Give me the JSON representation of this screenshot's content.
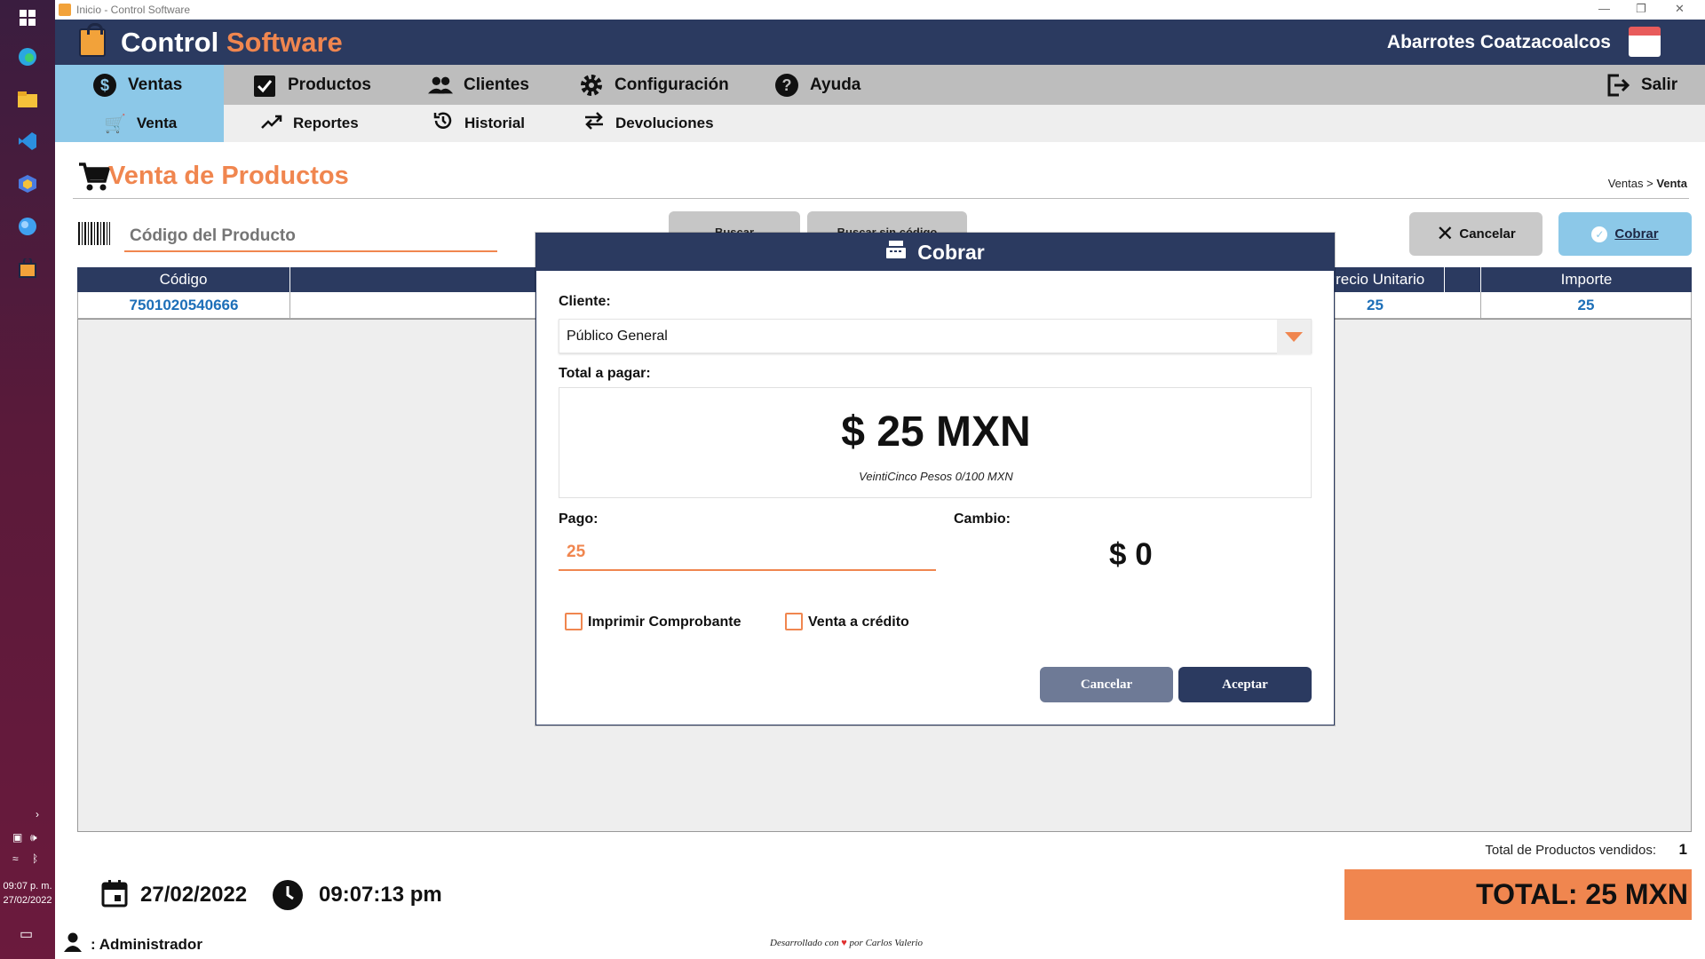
{
  "window": {
    "title": "Inicio - Control Software"
  },
  "brand": {
    "part1": "Control",
    "part2": "Software",
    "store": "Abarrotes Coatzacoalcos"
  },
  "mainnav": {
    "items": [
      {
        "label": "Ventas",
        "icon": "dollar-circle-icon"
      },
      {
        "label": "Productos",
        "icon": "clipboard-check-icon"
      },
      {
        "label": "Clientes",
        "icon": "users-icon"
      },
      {
        "label": "Configuración",
        "icon": "gear-icon"
      },
      {
        "label": "Ayuda",
        "icon": "help-circle-icon"
      }
    ],
    "logout": "Salir"
  },
  "subnav": {
    "items": [
      {
        "label": "Venta",
        "icon": "cart-icon"
      },
      {
        "label": "Reportes",
        "icon": "trend-up-icon"
      },
      {
        "label": "Historial",
        "icon": "history-icon"
      },
      {
        "label": "Devoluciones",
        "icon": "swap-icon"
      }
    ]
  },
  "page": {
    "title": "Venta de Productos",
    "breadcrumb_parent": "Ventas >",
    "breadcrumb_current": "Venta",
    "code_placeholder": "Código del Producto",
    "search_label": "Buscar",
    "search_no_code_label": "Buscar sin código",
    "cancel_label": "Cancelar",
    "cobrar_label": "Cobrar"
  },
  "table": {
    "headers": [
      "Código",
      "Precio Unitario",
      "Importe"
    ],
    "rows": [
      {
        "codigo": "7501020540666",
        "precio": "25",
        "importe": "25"
      }
    ]
  },
  "footer": {
    "total_products_label": "Total de Productos vendidos:",
    "total_products_count": "1",
    "total": "TOTAL: 25 MXN",
    "date": "27/02/2022",
    "time": "09:07:13 pm",
    "user": ": Administrador",
    "credit_pre": "Desarrollado con",
    "credit_post": "por Carlos Valerio"
  },
  "modal": {
    "title": "Cobrar",
    "cliente_label": "Cliente:",
    "cliente_value": "Público General",
    "total_label": "Total a pagar:",
    "total_amount": "$ 25 MXN",
    "total_words": "VeintiCinco Pesos 0/100 MXN",
    "pago_label": "Pago:",
    "pago_value": "25",
    "cambio_label": "Cambio:",
    "cambio_value": "$ 0",
    "print_label": "Imprimir Comprobante",
    "credit_label": "Venta a crédito",
    "cancel": "Cancelar",
    "accept": "Aceptar"
  },
  "taskbar": {
    "time": "09:07 p. m.",
    "date": "27/02/2022"
  },
  "colors": {
    "navy": "#2b3a60",
    "accent": "#f0864f",
    "active": "#8cc8e8"
  }
}
